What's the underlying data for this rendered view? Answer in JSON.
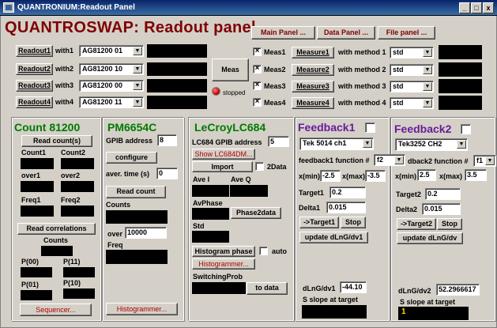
{
  "window": {
    "title": "QUANTRONIUM:Readout Panel",
    "min": "_",
    "max": "□",
    "close": "x"
  },
  "header": {
    "title": "QUANTROSWAP: Readout panel",
    "main_panel": "Main Panel ...",
    "data_panel": "Data Panel ...",
    "file_panel": "File panel ..."
  },
  "readouts": [
    {
      "button": "Readout1",
      "with": "with1",
      "device": "AG81200 01"
    },
    {
      "button": "Readout2",
      "with": "with2",
      "device": "AG81200 10"
    },
    {
      "button": "Readout3",
      "with": "with3",
      "device": "AG81200 00"
    },
    {
      "button": "Readout4",
      "with": "with4",
      "device": "AG81200 11"
    }
  ],
  "meas": {
    "button": "Meas",
    "status": "stopped"
  },
  "measures": [
    {
      "check": "Meas1",
      "button": "Measure1",
      "with": "with method 1",
      "method": "std",
      "checked": true
    },
    {
      "check": "Meas2",
      "button": "Measure2",
      "with": "with method 2",
      "method": "std",
      "checked": true
    },
    {
      "check": "Meas3",
      "button": "Measure3",
      "with": "with method 3",
      "method": "std",
      "checked": true
    },
    {
      "check": "Meas4",
      "button": "Measure4",
      "with": "with method 4",
      "method": "std",
      "checked": true
    }
  ],
  "count": {
    "title": "Count 81200",
    "read_counts": "Read count(s)",
    "count1": "Count1",
    "count2": "Count2",
    "over1": "over1",
    "over2": "over2",
    "freq1": "Freq1",
    "freq2": "Freq2",
    "read_corr": "Read correlations",
    "counts": "Counts",
    "p00": "P(00)",
    "p11": "P(11)",
    "p01": "P(01)",
    "p10": "P(10)",
    "sequencer": "Sequencer..."
  },
  "pm": {
    "title": "PM6654C",
    "gpib_label": "GPIB address",
    "gpib": "8",
    "configure": "configure",
    "aver_label": "aver. time (s)",
    "aver": "0",
    "read_count": "Read count",
    "counts": "Counts",
    "over_label": "over",
    "over": "10000",
    "freq": "Freq",
    "histogrammer": "Histogrammer..."
  },
  "lecroy": {
    "title": "LeCroyLC684",
    "gpib_label": "LC684 GPIB address",
    "gpib": "5",
    "show": "Show LC684DM...",
    "import": "Import",
    "twodata": "2Data",
    "avei": "Ave I",
    "aveq": "Ave Q",
    "avphase": "AvPhase",
    "phase2data": "Phase2data",
    "std": "Std",
    "histogram_phase": "Histogram phase",
    "auto": "auto",
    "histogrammer": "Histogrammer...",
    "switching": "SwitchingProb",
    "to_data": "to data"
  },
  "fb1": {
    "title": "Feedback1",
    "device": "Tek 5014 ch1",
    "func_label": "feedback1 function #",
    "func": "f2",
    "xmin_label": "x(min)",
    "xmin": "-2.5",
    "xmax_label": "x(max)",
    "xmax": "-3.5",
    "target_label": "Target1",
    "target": "0.2",
    "delta_label": "Delta1",
    "delta": "0.015",
    "to_target": "->Target1",
    "stop": "Stop",
    "update": "update dLnG/dv1",
    "dlng_label": "dLnG/dv1",
    "dlng": "-44.10",
    "slope": "S slope at target"
  },
  "fb2": {
    "title": "Feedback2",
    "device": "Tek3252 CH2",
    "func_label": "dback2 function #",
    "func": "f1",
    "xmin_label": "x(min)",
    "xmin": "2.5",
    "xmax_label": "x(max)",
    "xmax": "3.5",
    "target_label": "Target2",
    "target": "0.2",
    "delta_label": "Delta2",
    "delta": "0.015",
    "to_target": "->Target2",
    "stop": "Stop",
    "update": "update dLnG/dv",
    "dlng_label": "dLnG/dv2",
    "dlng": "52.2966617",
    "slope": "S slope at target",
    "slope_value": "1"
  },
  "colors": {
    "title_red": "#7f0000",
    "count_green": "#007a00",
    "feedback_purple": "#6a1b9a",
    "display_black": "#000000"
  }
}
